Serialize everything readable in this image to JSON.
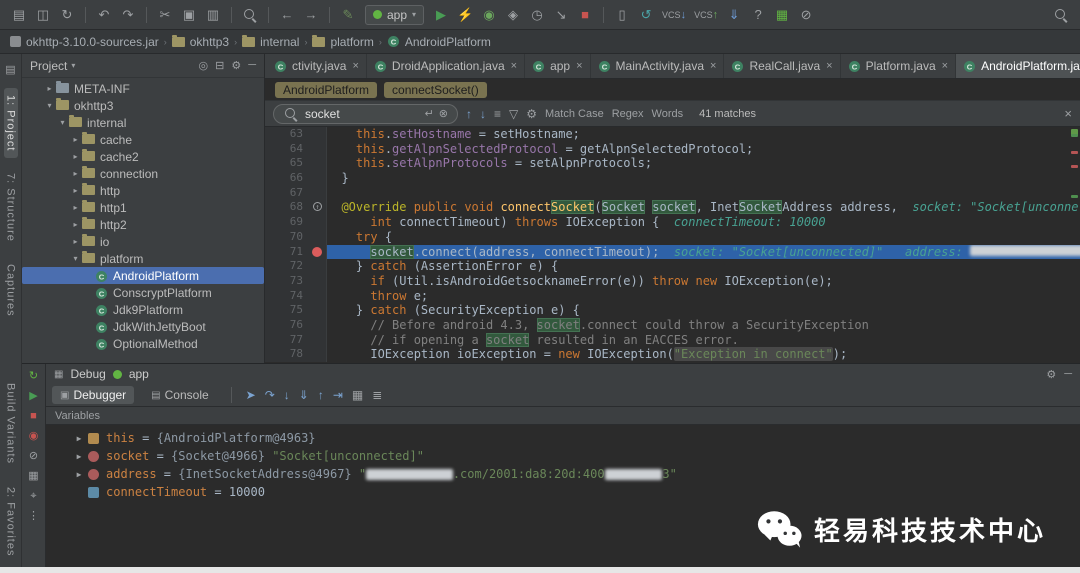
{
  "toolbar": {
    "items": [
      {
        "k": "i",
        "n": "open-project-icon",
        "g": "▤"
      },
      {
        "k": "i",
        "n": "save-all-icon",
        "g": "◫"
      },
      {
        "k": "i",
        "n": "sync-icon",
        "g": "↻"
      },
      {
        "k": "s"
      },
      {
        "k": "i",
        "n": "undo-icon",
        "g": "↶"
      },
      {
        "k": "i",
        "n": "redo-icon",
        "g": "↷"
      },
      {
        "k": "s"
      },
      {
        "k": "i",
        "n": "cut-icon",
        "g": "✂"
      },
      {
        "k": "i",
        "n": "copy-icon",
        "g": "▣"
      },
      {
        "k": "i",
        "n": "paste-icon",
        "g": "▥"
      },
      {
        "k": "s"
      },
      {
        "k": "m",
        "n": "find-icon"
      },
      {
        "k": "s"
      },
      {
        "k": "i",
        "n": "back-icon",
        "g": "←"
      },
      {
        "k": "i",
        "n": "forward-icon",
        "g": "→"
      },
      {
        "k": "s"
      },
      {
        "k": "i",
        "n": "edit-source-icon",
        "g": "✎",
        "c": "#6a8759"
      },
      {
        "k": "combo",
        "n": "run-configuration-combo",
        "label": "app"
      },
      {
        "k": "i",
        "n": "run-icon",
        "g": "▶",
        "c": "#499c54"
      },
      {
        "k": "i",
        "n": "apply-changes-icon",
        "g": "⚡",
        "c": "#c2b84a"
      },
      {
        "k": "i",
        "n": "debug-icon",
        "g": "◉",
        "c": "#6ba65d"
      },
      {
        "k": "i",
        "n": "coverage-icon",
        "g": "◈",
        "c": "#9da0a3"
      },
      {
        "k": "i",
        "n": "profiler-icon",
        "g": "◷",
        "c": "#9da0a3"
      },
      {
        "k": "i",
        "n": "attach-debugger-icon",
        "g": "↘",
        "c": "#9da0a3"
      },
      {
        "k": "i",
        "n": "stop-icon",
        "g": "■",
        "c": "#c75450"
      },
      {
        "k": "s"
      },
      {
        "k": "i",
        "n": "device-manager-icon",
        "g": "▯",
        "c": "#9da0a3"
      },
      {
        "k": "i",
        "n": "gradle-sync-icon",
        "g": "↺",
        "c": "#4aa5a8"
      },
      {
        "k": "vcs",
        "n": "vcs-update-icon",
        "label": "VCS",
        "arrow": "↓",
        "c": "#6e9bd5"
      },
      {
        "k": "vcs",
        "n": "vcs-commit-icon",
        "label": "VCS",
        "arrow": "↑",
        "c": "#6ba65d"
      },
      {
        "k": "i",
        "n": "sdk-manager-icon",
        "g": "⇓",
        "c": "#6e9bd5"
      },
      {
        "k": "i",
        "n": "help-icon",
        "g": "?",
        "c": "#9da0a3"
      },
      {
        "k": "i",
        "n": "layout-manager-icon",
        "g": "▦",
        "c": "#62b543"
      },
      {
        "k": "i",
        "n": "restriction-icon",
        "g": "⊘",
        "c": "#9da0a3"
      }
    ]
  },
  "navbar": {
    "items": [
      {
        "label": "okhttp-3.10.0-sources.jar",
        "icon": "jar"
      },
      {
        "label": "okhttp3",
        "icon": "pkg"
      },
      {
        "label": "internal",
        "icon": "pkg"
      },
      {
        "label": "platform",
        "icon": "pkg"
      },
      {
        "label": "AndroidPlatform",
        "icon": "class"
      }
    ],
    "separator": "›"
  },
  "stripe": {
    "top_toggle_icon": "▤",
    "top": [
      {
        "label": "1: Project",
        "active": true
      },
      {
        "label": "7: Structure",
        "active": false
      },
      {
        "label": "Captures",
        "active": false
      }
    ],
    "bottom": [
      {
        "label": "Build Variants",
        "active": false
      },
      {
        "label": "2: Favorites",
        "active": false
      }
    ]
  },
  "project": {
    "title": "Project",
    "title_caret": "▾",
    "header_icons": [
      {
        "n": "select-opened-file-icon",
        "g": "◎"
      },
      {
        "n": "collapse-all-icon",
        "g": "⊟"
      },
      {
        "n": "settings-icon",
        "g": "⚙"
      },
      {
        "n": "hide-panel-icon",
        "g": "─"
      }
    ],
    "tree": [
      {
        "label": "META-INF",
        "level": 1,
        "icon": "folder",
        "arrow": "▸",
        "selected": false
      },
      {
        "label": "okhttp3",
        "level": 1,
        "icon": "pkg",
        "arrow": "▾",
        "selected": false
      },
      {
        "label": "internal",
        "level": 2,
        "icon": "pkg",
        "arrow": "▾",
        "selected": false
      },
      {
        "label": "cache",
        "level": 3,
        "icon": "pkg",
        "arrow": "▸",
        "selected": false
      },
      {
        "label": "cache2",
        "level": 3,
        "icon": "pkg",
        "arrow": "▸",
        "selected": false
      },
      {
        "label": "connection",
        "level": 3,
        "icon": "pkg",
        "arrow": "▸",
        "selected": false
      },
      {
        "label": "http",
        "level": 3,
        "icon": "pkg",
        "arrow": "▸",
        "selected": false
      },
      {
        "label": "http1",
        "level": 3,
        "icon": "pkg",
        "arrow": "▸",
        "selected": false
      },
      {
        "label": "http2",
        "level": 3,
        "icon": "pkg",
        "arrow": "▸",
        "selected": false
      },
      {
        "label": "io",
        "level": 3,
        "icon": "pkg",
        "arrow": "▸",
        "selected": false
      },
      {
        "label": "platform",
        "level": 3,
        "icon": "pkg",
        "arrow": "▾",
        "selected": false
      },
      {
        "label": "AndroidPlatform",
        "level": 4,
        "icon": "class",
        "arrow": "",
        "selected": true
      },
      {
        "label": "ConscryptPlatform",
        "level": 4,
        "icon": "class",
        "arrow": "",
        "selected": false
      },
      {
        "label": "Jdk9Platform",
        "level": 4,
        "icon": "class",
        "arrow": "",
        "selected": false
      },
      {
        "label": "JdkWithJettyBoot",
        "level": 4,
        "icon": "class",
        "arrow": "",
        "selected": false
      },
      {
        "label": "OptionalMethod",
        "level": 4,
        "icon": "class",
        "arrow": "",
        "selected": false
      }
    ]
  },
  "editor": {
    "tabs": [
      {
        "label": "ctivity.java",
        "active": false
      },
      {
        "label": "DroidApplication.java",
        "active": false
      },
      {
        "label": "app",
        "active": false
      },
      {
        "label": "MainActivity.java",
        "active": false
      },
      {
        "label": "RealCall.java",
        "active": false
      },
      {
        "label": "Platform.java",
        "active": false
      },
      {
        "label": "AndroidPlatform.java",
        "active": true
      }
    ],
    "tab_close_glyph": "×",
    "tab_overflow_glyph": "▾",
    "breadcrumbs": [
      "AndroidPlatform",
      "connectSocket()"
    ],
    "find": {
      "query": "socket",
      "enter_glyph": "↵",
      "clear_glyph": "⊗",
      "icons": [
        {
          "n": "previous-occurrence-icon",
          "g": "↑",
          "c": "#7ba3d0"
        },
        {
          "n": "next-occurrence-icon",
          "g": "↓",
          "c": "#7ba3d0"
        },
        {
          "n": "find-all-icon",
          "g": "≡",
          "c": "#9da0a3"
        },
        {
          "n": "filter-icon",
          "g": "▽",
          "c": "#9da0a3"
        },
        {
          "n": "search-settings-icon",
          "g": "⚙",
          "c": "#9da0a3"
        }
      ],
      "options": [
        "Match Case",
        "Regex",
        "Words"
      ],
      "count": "41 matches",
      "close_glyph": "×"
    },
    "lines": [
      {
        "n": 63,
        "tok": [
          [
            "p",
            "    "
          ],
          [
            "k",
            "this"
          ],
          [
            "p",
            "."
          ],
          [
            "f",
            "setHostname"
          ],
          [
            "p",
            " = setHostname;"
          ]
        ]
      },
      {
        "n": 64,
        "tok": [
          [
            "p",
            "    "
          ],
          [
            "k",
            "this"
          ],
          [
            "p",
            "."
          ],
          [
            "f",
            "getAlpnSelectedProtocol"
          ],
          [
            "p",
            " = getAlpnSelectedProtocol;"
          ]
        ]
      },
      {
        "n": 65,
        "tok": [
          [
            "p",
            "    "
          ],
          [
            "k",
            "this"
          ],
          [
            "p",
            "."
          ],
          [
            "f",
            "setAlpnProtocols"
          ],
          [
            "p",
            " = setAlpnProtocols;"
          ]
        ]
      },
      {
        "n": 66,
        "tok": [
          [
            "p",
            "  }"
          ]
        ]
      },
      {
        "n": 67,
        "tok": []
      },
      {
        "n": 68,
        "marker": "override",
        "tok": [
          [
            "p",
            "  "
          ],
          [
            "a",
            "@Override"
          ],
          [
            "p",
            " "
          ],
          [
            "k",
            "public"
          ],
          [
            "p",
            " "
          ],
          [
            "k",
            "void"
          ],
          [
            "p",
            " "
          ],
          [
            "m",
            "connect"
          ],
          [
            "m hl",
            "Socket"
          ],
          [
            "p",
            "("
          ],
          [
            "p hl",
            "Socket"
          ],
          [
            "p",
            " "
          ],
          [
            "p hl",
            "socket"
          ],
          [
            "p",
            ", Inet"
          ],
          [
            "p hl",
            "Socket"
          ],
          [
            "p",
            "Address address,  "
          ],
          [
            "h",
            "socket: \"Socket[unconne"
          ]
        ]
      },
      {
        "n": 69,
        "tok": [
          [
            "p",
            "      "
          ],
          [
            "k",
            "int"
          ],
          [
            "p",
            " connectTimeout) "
          ],
          [
            "k",
            "throws"
          ],
          [
            "p",
            " IOException {  "
          ],
          [
            "h",
            "connectTimeout: 10000"
          ]
        ]
      },
      {
        "n": 70,
        "tok": [
          [
            "p",
            "    "
          ],
          [
            "k",
            "try"
          ],
          [
            "p",
            " {"
          ]
        ]
      },
      {
        "n": 71,
        "bp": true,
        "exec": true,
        "tok": [
          [
            "p",
            "      "
          ],
          [
            "p hl",
            "socket"
          ],
          [
            "p",
            ".connect(address, connectTimeout);  "
          ],
          [
            "h",
            "socket: \"Socket[unconnected]\"   address: "
          ],
          [
            "red",
            "                          "
          ]
        ]
      },
      {
        "n": 72,
        "tok": [
          [
            "p",
            "    } "
          ],
          [
            "k",
            "catch"
          ],
          [
            "p",
            " (AssertionError e) {"
          ]
        ]
      },
      {
        "n": 73,
        "tok": [
          [
            "p",
            "      "
          ],
          [
            "k",
            "if"
          ],
          [
            "p",
            " (Util.isAndroidGetsocknameError(e)) "
          ],
          [
            "k",
            "throw"
          ],
          [
            "p",
            " "
          ],
          [
            "k",
            "new"
          ],
          [
            "p",
            " IOException(e);"
          ]
        ]
      },
      {
        "n": 74,
        "tok": [
          [
            "p",
            "      "
          ],
          [
            "k",
            "throw"
          ],
          [
            "p",
            " e;"
          ]
        ]
      },
      {
        "n": 75,
        "tok": [
          [
            "p",
            "    } "
          ],
          [
            "k",
            "catch"
          ],
          [
            "p",
            " (SecurityException e) {"
          ]
        ]
      },
      {
        "n": 76,
        "tok": [
          [
            "c",
            "      // Before android 4.3, "
          ],
          [
            "c hl",
            "socket"
          ],
          [
            "c",
            ".connect could throw a SecurityException"
          ]
        ]
      },
      {
        "n": 77,
        "tok": [
          [
            "c",
            "      // if opening a "
          ],
          [
            "c hl",
            "socket"
          ],
          [
            "c",
            " resulted in an EACCES error."
          ]
        ]
      },
      {
        "n": 78,
        "tok": [
          [
            "p",
            "      IOException ioException = "
          ],
          [
            "k",
            "new"
          ],
          [
            "p",
            " IOException("
          ],
          [
            "s sel",
            "\"Exception in connect\""
          ],
          [
            "p",
            ");"
          ]
        ]
      }
    ],
    "stripe_marks": [
      {
        "t": 3,
        "c": "#4f8f4f"
      },
      {
        "t": 10,
        "c": "#b55555"
      },
      {
        "t": 16,
        "c": "#b55555"
      },
      {
        "t": 29,
        "c": "#4f8f4f"
      }
    ]
  },
  "debug": {
    "window_icon": "▦",
    "title": "Debug",
    "session": "app",
    "right_icons": [
      {
        "n": "settings-icon",
        "g": "⚙"
      },
      {
        "n": "minimize-icon",
        "g": "─"
      }
    ],
    "left_icons": [
      {
        "n": "rerun-icon",
        "g": "↻",
        "c": "#62b543"
      },
      {
        "n": "resume-icon",
        "g": "▶",
        "c": "#499c54"
      },
      {
        "n": "stop-icon",
        "g": "■",
        "c": "#c75450"
      },
      {
        "n": "view-breakpoints-icon",
        "g": "◉",
        "c": "#c75450"
      },
      {
        "n": "mute-breakpoints-icon",
        "g": "⊘",
        "c": "#9da0a3"
      },
      {
        "n": "restore-layout-icon",
        "g": "▦",
        "c": "#9da0a3"
      },
      {
        "n": "pin-icon",
        "g": "⌖",
        "c": "#9da0a3"
      },
      {
        "n": "more-icon",
        "g": "⋮",
        "c": "#9da0a3"
      }
    ],
    "tabs": [
      {
        "label": "Debugger",
        "icon": "▣",
        "active": true
      },
      {
        "label": "Console",
        "icon": "▤",
        "active": false
      }
    ],
    "step_icons": [
      {
        "n": "show-execution-point-icon",
        "g": "➤",
        "c": "#7ba3d0"
      },
      {
        "n": "step-over-icon",
        "g": "↷",
        "c": "#7ba3d0"
      },
      {
        "n": "step-into-icon",
        "g": "↓",
        "c": "#7ba3d0"
      },
      {
        "n": "force-step-into-icon",
        "g": "⇓",
        "c": "#7ba3d0"
      },
      {
        "n": "step-out-icon",
        "g": "↑",
        "c": "#7ba3d0"
      },
      {
        "n": "run-to-cursor-icon",
        "g": "⇥",
        "c": "#7ba3d0"
      },
      {
        "n": "evaluate-expression-icon",
        "g": "▦",
        "c": "#9da0a3"
      },
      {
        "n": "stack-frames-icon",
        "g": "≣",
        "c": "#9da0a3"
      }
    ],
    "variables_title": "Variables",
    "variables": [
      {
        "icon": "this",
        "arrow": "▶",
        "tok": [
          [
            "vn",
            "this"
          ],
          [
            "vp",
            " = "
          ],
          [
            "vo",
            "{AndroidPlatform@4963}"
          ]
        ]
      },
      {
        "icon": "obj",
        "arrow": "▶",
        "tok": [
          [
            "vn",
            "socket"
          ],
          [
            "vp",
            " = "
          ],
          [
            "vo",
            "{Socket@4966}"
          ],
          [
            "vp",
            " "
          ],
          [
            "vs",
            "\"Socket[unconnected]\""
          ]
        ]
      },
      {
        "icon": "obj",
        "arrow": "▶",
        "tok": [
          [
            "vn",
            "address"
          ],
          [
            "vp",
            " = "
          ],
          [
            "vo",
            "{InetSocketAddress@4967}"
          ],
          [
            "vp",
            " "
          ],
          [
            "vs",
            "\""
          ],
          [
            "red",
            "            "
          ],
          [
            "vs",
            ".com/2001:da8:20d:400"
          ],
          [
            "red",
            "        "
          ],
          [
            "vs",
            "3\""
          ]
        ]
      },
      {
        "icon": "prim",
        "arrow": "",
        "tok": [
          [
            "vn",
            "connectTimeout"
          ],
          [
            "vp",
            " = "
          ],
          [
            "vnum",
            "10000"
          ]
        ]
      }
    ]
  },
  "watermark": {
    "text": "轻易科技技术中心"
  }
}
